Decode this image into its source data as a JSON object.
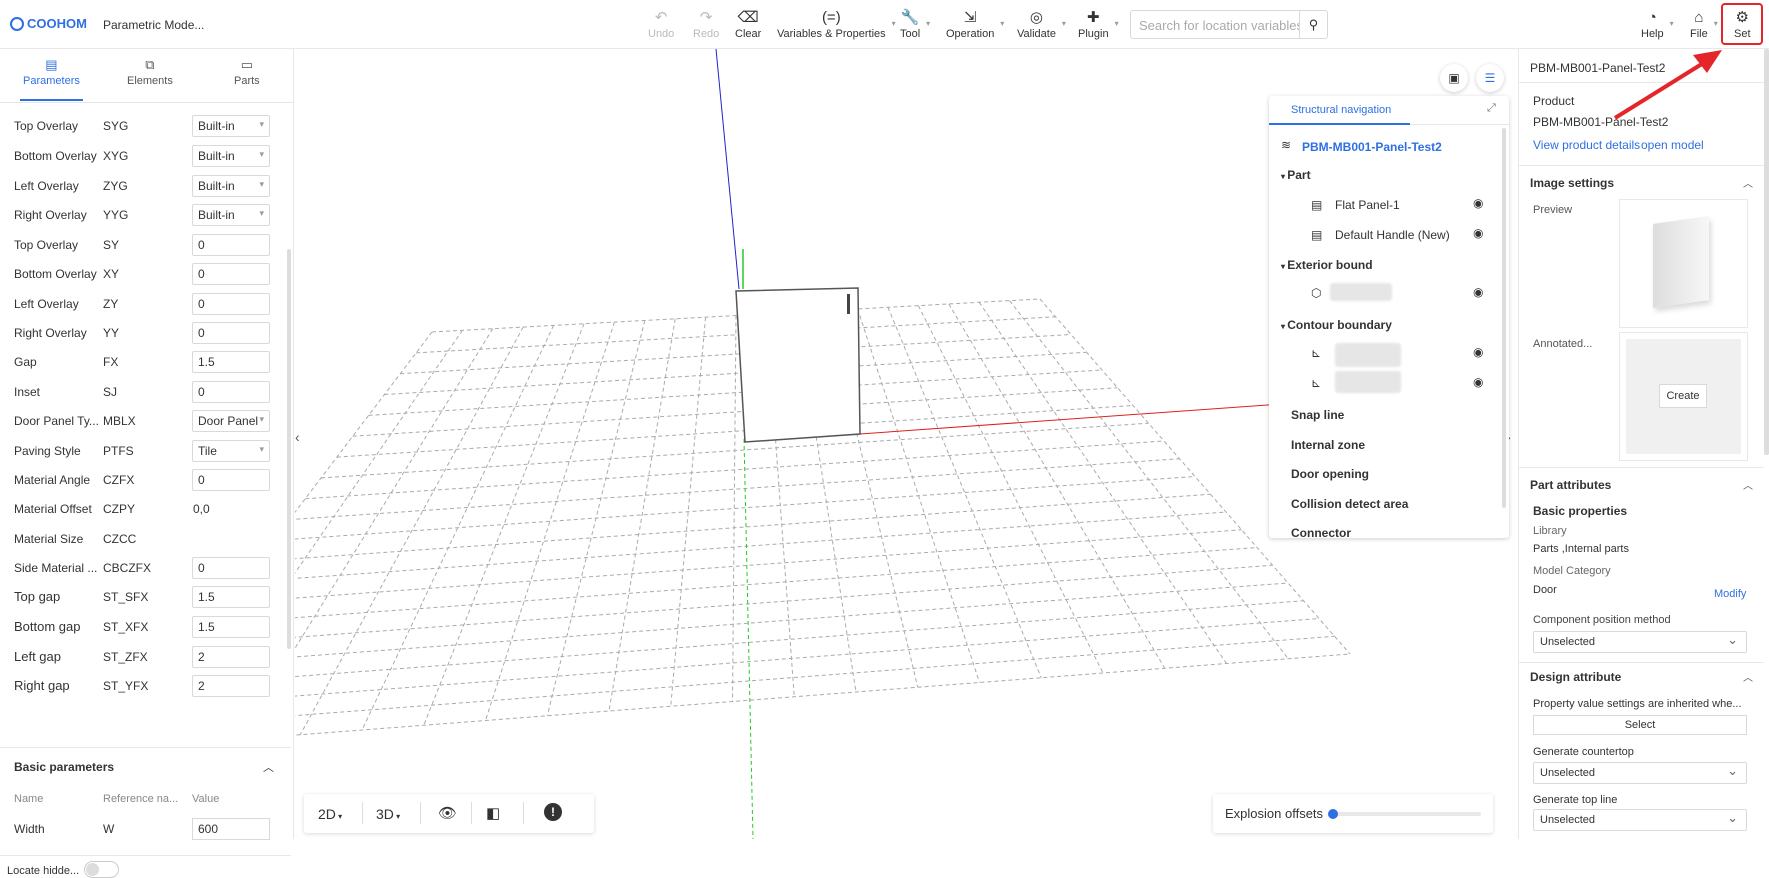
{
  "app": {
    "logo": "COOHOM",
    "title": "Parametric Mode..."
  },
  "toolbar": {
    "undo": "Undo",
    "redo": "Redo",
    "clear": "Clear",
    "variables": "Variables & Properties",
    "tool": "Tool",
    "operation": "Operation",
    "validate": "Validate",
    "plugin": "Plugin",
    "search_placeholder": "Search for location variables",
    "help": "Help",
    "file": "File",
    "set": "Set"
  },
  "left": {
    "tabs": [
      "Parameters",
      "Elements",
      "Parts"
    ],
    "rows": [
      {
        "name": "Top Overlay",
        "code": "SYG",
        "value": "Built-in",
        "kind": "select"
      },
      {
        "name": "Bottom Overlay",
        "code": "XYG",
        "value": "Built-in",
        "kind": "select"
      },
      {
        "name": "Left Overlay",
        "code": "ZYG",
        "value": "Built-in",
        "kind": "select"
      },
      {
        "name": "Right Overlay",
        "code": "YYG",
        "value": "Built-in",
        "kind": "select"
      },
      {
        "name": "Top Overlay",
        "code": "SY",
        "value": "0",
        "kind": "input"
      },
      {
        "name": "Bottom Overlay",
        "code": "XY",
        "value": "0",
        "kind": "input"
      },
      {
        "name": "Left Overlay",
        "code": "ZY",
        "value": "0",
        "kind": "input"
      },
      {
        "name": "Right Overlay",
        "code": "YY",
        "value": "0",
        "kind": "input"
      },
      {
        "name": "Gap",
        "code": "FX",
        "value": "1.5",
        "kind": "input"
      },
      {
        "name": "Inset",
        "code": "SJ",
        "value": "0",
        "kind": "input"
      },
      {
        "name": "Door Panel Ty...",
        "code": "MBLX",
        "value": "Door Panel",
        "kind": "select"
      },
      {
        "name": "Paving Style",
        "code": "PTFS",
        "value": "Tile",
        "kind": "select"
      },
      {
        "name": "Material Angle",
        "code": "CZFX",
        "value": "0",
        "kind": "input"
      },
      {
        "name": "Material Offset",
        "code": "CZPY",
        "value": "0,0",
        "kind": "text"
      },
      {
        "name": "Material Size",
        "code": "CZCC",
        "value": "",
        "kind": "text"
      },
      {
        "name": "Side Material ...",
        "code": "CBCZFX",
        "value": "0",
        "kind": "input"
      },
      {
        "name": "Top gap",
        "code": "ST_SFX",
        "value": "1.5",
        "kind": "input",
        "big": true
      },
      {
        "name": "Bottom gap",
        "code": "ST_XFX",
        "value": "1.5",
        "kind": "input",
        "big": true
      },
      {
        "name": "Left gap",
        "code": "ST_ZFX",
        "value": "2",
        "kind": "input",
        "big": true
      },
      {
        "name": "Right gap",
        "code": "ST_YFX",
        "value": "2",
        "kind": "input",
        "big": true
      }
    ],
    "basic": {
      "title": "Basic parameters",
      "col_name": "Name",
      "col_ref": "Reference na...",
      "col_value": "Value",
      "width_name": "Width",
      "width_code": "W",
      "width_value": "600"
    },
    "locate": "Locate hidde..."
  },
  "nav": {
    "title": "Structural navigation",
    "root": "PBM-MB001-Panel-Test2",
    "part": "Part",
    "flat": "Flat Panel-1",
    "handle": "Default Handle (New)",
    "exterior": "Exterior bound",
    "contour": "Contour boundary",
    "snap": "Snap line",
    "internal": "Internal zone",
    "door": "Door opening",
    "collision": "Collision detect area",
    "connector": "Connector"
  },
  "bottom": {
    "d2": "2D",
    "d3": "3D",
    "explosion": "Explosion offsets"
  },
  "right": {
    "header": "PBM-MB001-Panel-Test2",
    "product_label": "Product",
    "product": "PBM-MB001-Panel-Test2",
    "view": "View product details",
    "open": "open model",
    "image_settings": "Image settings",
    "preview": "Preview",
    "annotated": "Annotated...",
    "create": "Create",
    "part_attributes": "Part attributes",
    "basic_props": "Basic properties",
    "library_label": "Library",
    "library": "Parts ,Internal parts",
    "category_label": "Model Category",
    "category": "Door",
    "modify": "Modify",
    "comp_pos": "Component position method",
    "unselected": "Unselected",
    "design_attr": "Design attribute",
    "inherited": "Property value settings are inherited whe...",
    "select": "Select",
    "countertop": "Generate countertop",
    "topline": "Generate top line"
  },
  "colors": {
    "accent": "#2f6fe4",
    "highlight": "#e4252a"
  }
}
